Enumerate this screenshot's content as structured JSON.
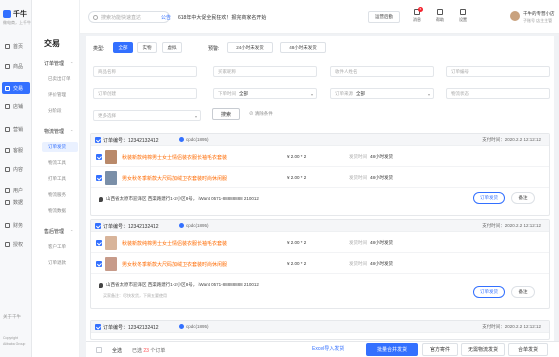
{
  "app": {
    "logo_name": "千牛",
    "logo_sub": "做电商，上千牛",
    "footer_title": "关于千牛",
    "footer_line1": "Copyright",
    "footer_line2": "Alibaba Group"
  },
  "nav": [
    {
      "label": "首页",
      "icon": "home-icon",
      "active": false
    },
    {
      "label": "商品",
      "icon": "goods-icon",
      "active": false
    },
    {
      "label": "交易",
      "icon": "trade-icon",
      "active": true
    },
    {
      "label": "店铺",
      "icon": "shop-icon",
      "active": false
    },
    {
      "label": "营销",
      "icon": "marketing-icon",
      "active": false
    },
    {
      "label": "客服",
      "icon": "service-icon",
      "active": false
    },
    {
      "label": "内容",
      "icon": "content-icon",
      "active": false
    },
    {
      "label": "用户",
      "icon": "user-icon",
      "active": false
    },
    {
      "label": "数据",
      "icon": "data-icon",
      "active": false
    },
    {
      "label": "财务",
      "icon": "finance-icon",
      "active": false
    },
    {
      "label": "授权",
      "icon": "auth-icon",
      "active": false
    }
  ],
  "subnav": {
    "title": "交易",
    "groups": [
      {
        "label": "订单管理",
        "items": [
          "已卖出订单",
          "评价管理",
          "分阶段"
        ]
      },
      {
        "label": "物流管理",
        "items": [
          "订单发货",
          "物流工具",
          "打单工具",
          "物流服务",
          "物流数据"
        ]
      },
      {
        "label": "售后管理",
        "items": [
          "客户工单",
          "订单退款"
        ]
      }
    ],
    "active_item": "订单发货"
  },
  "header": {
    "search_placeholder": "搜索功能快速直达",
    "notice_label": "公告",
    "notice_text": "618年中大促全民狂欢！报完商家名开始",
    "invite_button": "运营后勤",
    "icons": [
      {
        "label": "消息",
        "icon": "bell-icon",
        "badge": "5"
      },
      {
        "label": "帮助",
        "icon": "help-icon",
        "badge": ""
      },
      {
        "label": "设置",
        "icon": "settings-icon",
        "badge": ""
      }
    ],
    "user_name": "千牛的专营小店",
    "user_role": "子账号 店主主管"
  },
  "filters": {
    "type_label": "类型:",
    "type_options": [
      "全部",
      "实物",
      "虚拟"
    ],
    "type_selected": "全部",
    "time_label": "预警:",
    "time_options": [
      "24小时未发货",
      "48小时未发货"
    ],
    "fields": [
      {
        "label": "",
        "placeholder": "商品名称",
        "value": "",
        "dropdown": false
      },
      {
        "label": "",
        "placeholder": "买家昵称",
        "value": "",
        "dropdown": false
      },
      {
        "label": "",
        "placeholder": "收件人姓名",
        "value": "",
        "dropdown": false
      },
      {
        "label": "",
        "placeholder": "订单编号",
        "value": "",
        "dropdown": false
      },
      {
        "label": "",
        "placeholder": "订单创建",
        "value": "",
        "dropdown": false
      },
      {
        "label": "下单时间",
        "placeholder": "",
        "value": "全部",
        "dropdown": true
      },
      {
        "label": "订单来源",
        "placeholder": "",
        "value": "全部",
        "dropdown": true
      },
      {
        "label": "",
        "placeholder": "物流状态",
        "value": "",
        "dropdown": false
      },
      {
        "label": "",
        "placeholder": "更多选择",
        "value": "",
        "dropdown": true
      }
    ],
    "search_button": "搜索",
    "clear_link": "清除条件"
  },
  "orders": [
    {
      "order_no": "订单编号：12342132412",
      "tag": "cpdc(1895)",
      "pay_time": "支付时间：2020.2.2 12:12:12",
      "products": [
        {
          "title": "秋装新款纯棉男士女士情侣装衣服长袖毛衣套装",
          "price": "¥ 2.00 * 2",
          "ship_label": "发货时间",
          "ship_value": "48小时发货",
          "thumb": "#b9896a"
        },
        {
          "title": "男女秋冬季新款大尺码加绒卫衣套装时尚休闲服",
          "price": "¥ 2.00 * 2",
          "ship_label": "发货时间",
          "ship_value": "48小时发货",
          "thumb": "#7a8fa8"
        }
      ],
      "address": "山西省太原市迎泽区 西渠路建行1-2小区8号，  iWant  0571-88888888  210012",
      "note": "",
      "ship_button": "订单发货",
      "remark_button": "备注",
      "checked": true
    },
    {
      "order_no": "订单编号：12342132412",
      "tag": "cpdc(1895)",
      "pay_time": "支付时间：2020.2.2 12:12:12",
      "products": [
        {
          "title": "秋装新款纯棉男士女士情侣装衣服长袖毛衣套装",
          "price": "¥ 2.00 * 2",
          "ship_label": "发货时间",
          "ship_value": "48小时发货",
          "thumb": "#d8b49a"
        },
        {
          "title": "男女秋冬季新款大尺码加绒卫衣套装时尚休闲服",
          "price": "¥ 2.00 * 2",
          "ship_label": "发货时间",
          "ship_value": "48小时发货",
          "thumb": "#c79b8a"
        }
      ],
      "address": "山西省太原市迎泽区 西渠路建行1-2小区8号，  iWant  0571-88888888  210012",
      "note": "买家备注：尽快发货，下周五要使用",
      "ship_button": "订单发货",
      "remark_button": "备注",
      "checked": true
    },
    {
      "order_no": "订单编号：12342132412",
      "tag": "cpdc(1895)",
      "pay_time": "支付时间：2020.2.2 12:12:12",
      "checked": true
    }
  ],
  "bottom": {
    "select_all": "全选",
    "selected_prefix": "已选",
    "selected_count": "23",
    "selected_suffix": "个订单",
    "excel_link": "Excel导入发货",
    "buttons": [
      "批量合并发货",
      "官方寄件",
      "无需物流发货",
      "合单发货"
    ]
  },
  "colors": {
    "accent": "#3370ff",
    "product_title": "#ff6a00",
    "badge": "#f5222d"
  }
}
